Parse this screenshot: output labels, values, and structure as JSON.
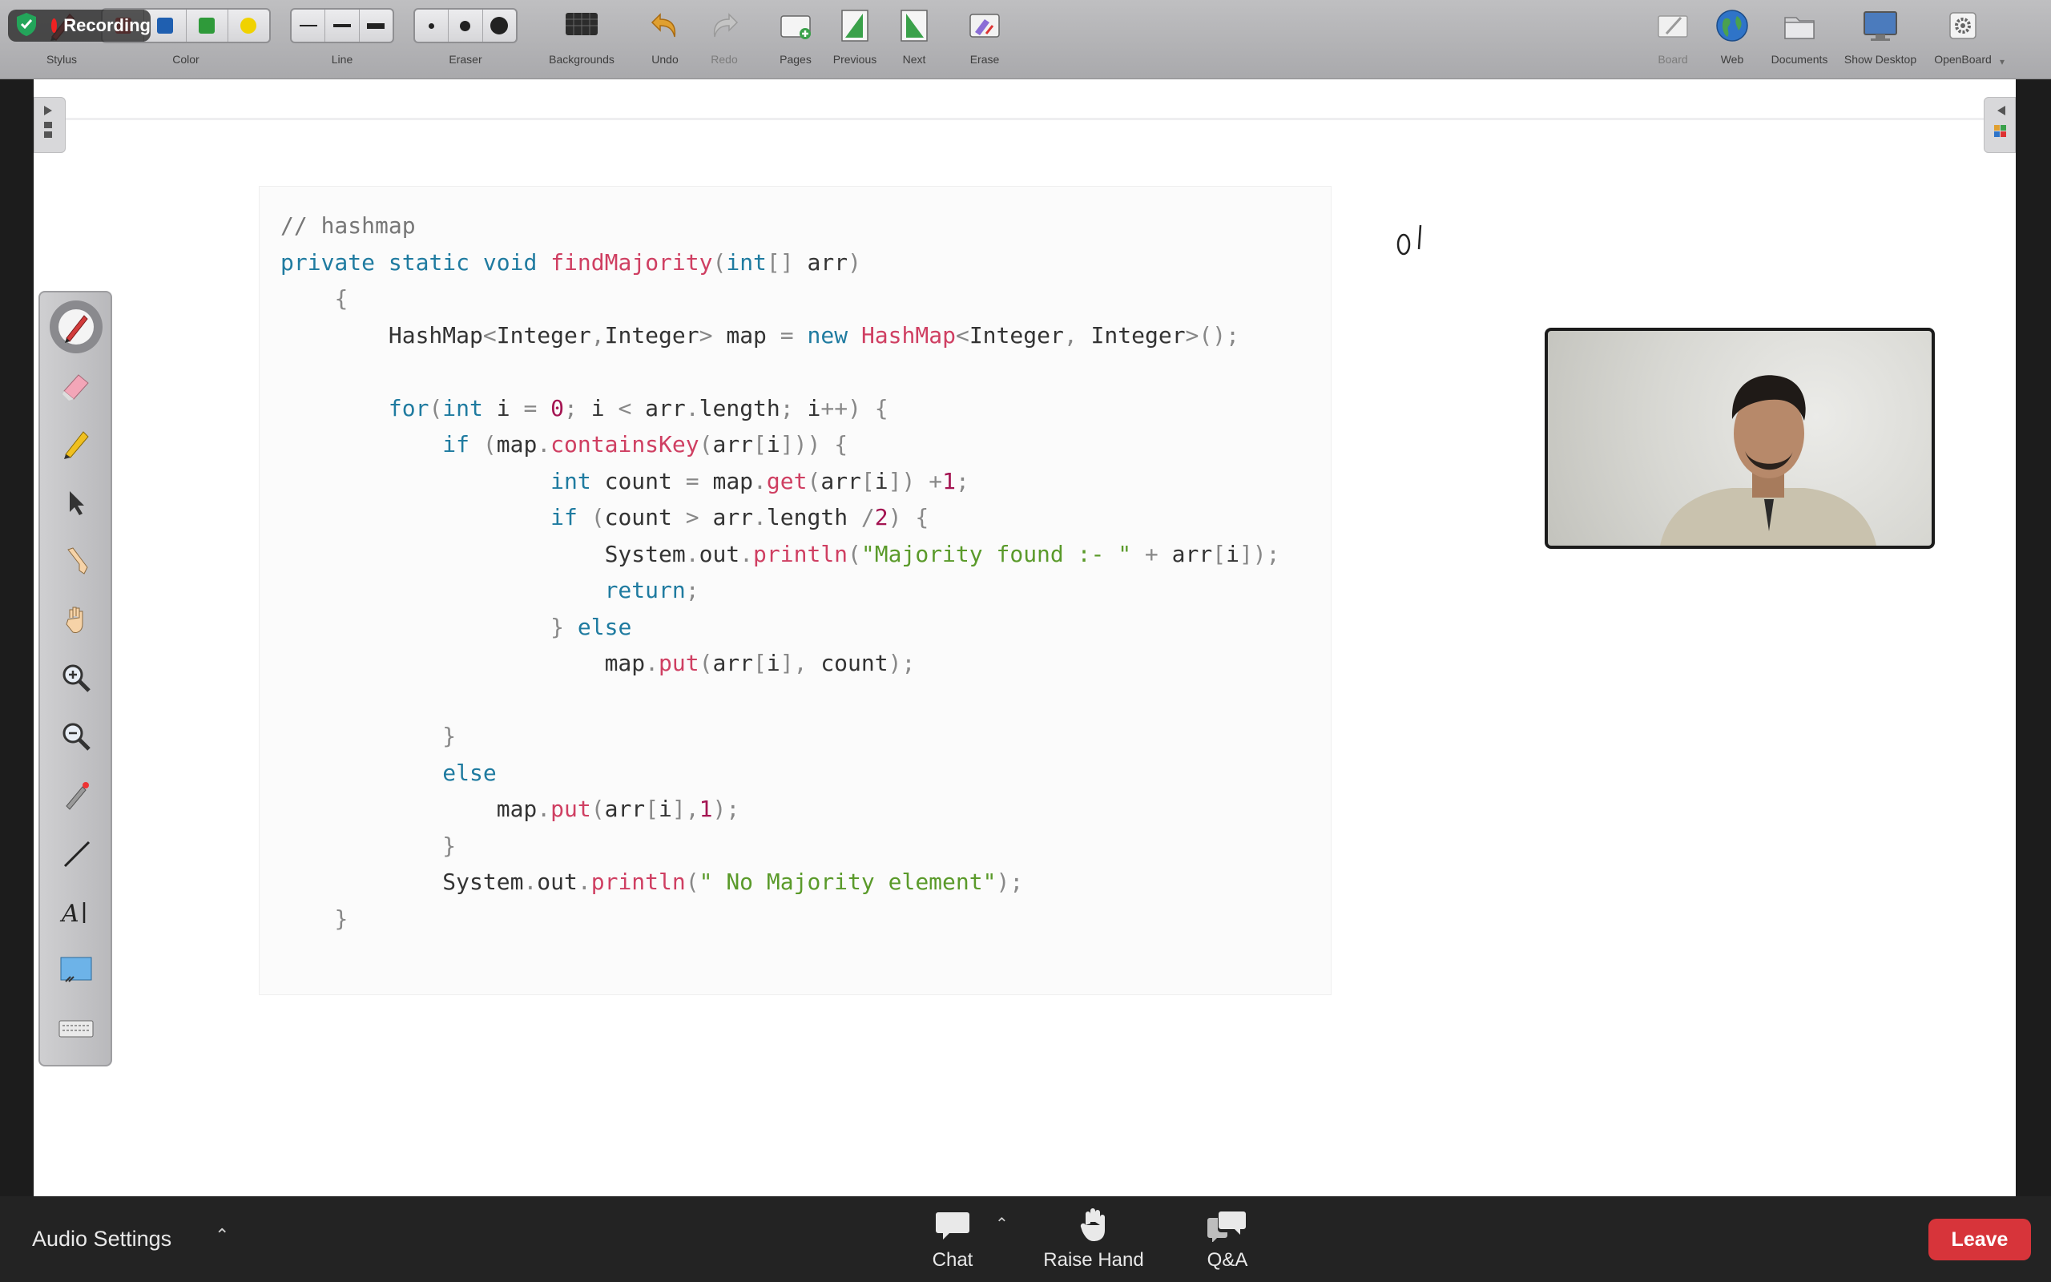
{
  "recording": {
    "label": "Recording"
  },
  "toolbar": {
    "left_groups": [
      {
        "id": "stylus",
        "label": "Stylus"
      },
      {
        "id": "color",
        "label": "Color"
      },
      {
        "id": "line",
        "label": "Line"
      },
      {
        "id": "eraser",
        "label": "Eraser"
      },
      {
        "id": "backgrounds",
        "label": "Backgrounds"
      },
      {
        "id": "undo",
        "label": "Undo"
      },
      {
        "id": "redo",
        "label": "Redo"
      },
      {
        "id": "pages",
        "label": "Pages"
      },
      {
        "id": "previous",
        "label": "Previous"
      },
      {
        "id": "next",
        "label": "Next"
      },
      {
        "id": "erase",
        "label": "Erase"
      }
    ],
    "right_groups": [
      {
        "id": "board",
        "label": "Board"
      },
      {
        "id": "web",
        "label": "Web"
      },
      {
        "id": "documents",
        "label": "Documents"
      },
      {
        "id": "show_desktop",
        "label": "Show Desktop"
      },
      {
        "id": "openboard",
        "label": "OpenBoard"
      }
    ],
    "colors": [
      "#e23b3b",
      "#1f5fb0",
      "#2f9a3a",
      "#f0d200"
    ]
  },
  "code": {
    "language": "java",
    "lines": [
      "// hashmap",
      "private static void findMajority(int[] arr)",
      "    {",
      "        HashMap<Integer,Integer> map = new HashMap<Integer, Integer>();",
      "",
      "        for(int i = 0; i < arr.length; i++) {",
      "            if (map.containsKey(arr[i])) {",
      "                    int count = map.get(arr[i]) +1;",
      "                    if (count > arr.length /2) {",
      "                        System.out.println(\"Majority found :- \" + arr[i]);",
      "                        return;",
      "                    } else",
      "                        map.put(arr[i], count);",
      "",
      "            }",
      "            else",
      "                map.put(arr[i],1);",
      "            }",
      "            System.out.println(\" No Majority element\");",
      "    }"
    ]
  },
  "annotation": {
    "text": "0|"
  },
  "zoom": {
    "audio_settings": "Audio Settings",
    "chat": "Chat",
    "raise_hand": "Raise Hand",
    "qa": "Q&A",
    "leave": "Leave"
  }
}
